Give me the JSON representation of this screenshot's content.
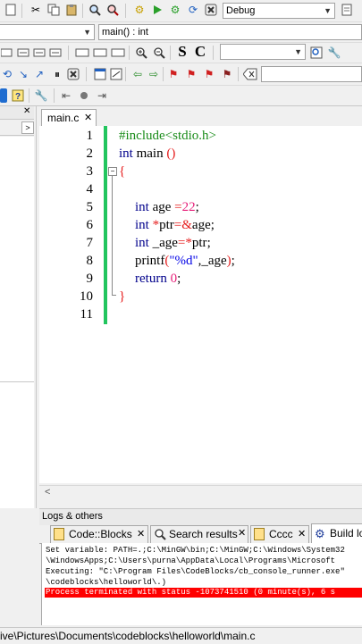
{
  "toolbar": {
    "build_target": "Debug",
    "function_scope": "main() : int",
    "letter_s": "S",
    "letter_c": "C"
  },
  "editor": {
    "tab_label": "main.c",
    "tab_close": "✕",
    "lines": [
      {
        "n": "1"
      },
      {
        "n": "2"
      },
      {
        "n": "3"
      },
      {
        "n": "4"
      },
      {
        "n": "5"
      },
      {
        "n": "6"
      },
      {
        "n": "7"
      },
      {
        "n": "8"
      },
      {
        "n": "9"
      },
      {
        "n": "10"
      },
      {
        "n": "11"
      }
    ],
    "code": {
      "l1": "#include<stdio.h>",
      "l2_kw": "int",
      "l2_rest": " main ",
      "l2_paren": "()",
      "l3": "{",
      "l5_kw": "int",
      "l5_id": " age ",
      "l5_op": "=",
      "l5_num": "22",
      "l5_end": ";",
      "l6_kw": "int",
      "l6_sp": " ",
      "l6_op1": "*",
      "l6_id": "ptr",
      "l6_op2": "=&",
      "l6_id2": "age",
      "l6_end": ";",
      "l7_kw": "int",
      "l7_id": " _age",
      "l7_op": "=*",
      "l7_id2": "ptr",
      "l7_end": ";",
      "l8_fn": "printf",
      "l8_p1": "(",
      "l8_str": "\"%d\"",
      "l8_mid": ",_age",
      "l8_p2": ")",
      "l8_end": ";",
      "l9_kw": "return",
      "l9_sp": " ",
      "l9_num": "0",
      "l9_end": ";",
      "l10": "}"
    }
  },
  "logs": {
    "panel_title": "Logs & others",
    "tabs": [
      {
        "label": "Code::Blocks",
        "close": "✕"
      },
      {
        "label": "Search results",
        "close": "✕"
      },
      {
        "label": "Cccc",
        "close": "✕"
      },
      {
        "label": "Build lo",
        "close": ""
      }
    ],
    "lines": [
      "Set variable: PATH=.;C:\\MinGW\\bin;C:\\MinGW;C:\\Windows\\System32",
      "\\WindowsApps;C:\\Users\\purna\\AppData\\Local\\Programs\\Microsoft",
      "Executing: \"C:\\Program Files\\CodeBlocks/cb_console_runner.exe\"",
      "\\codeblocks\\helloworld\\.)",
      "Process terminated with status -1073741510 (0 minute(s), 6 s"
    ]
  },
  "status_bar": {
    "path": "ive\\Pictures\\Documents\\codeblocks\\helloworld\\main.c"
  },
  "colors": {
    "error_bg": "#ff0000",
    "change_bar": "#22c55e",
    "keyword": "#00008b",
    "number": "#e61e78",
    "preprocessor": "#1a8c1a"
  }
}
